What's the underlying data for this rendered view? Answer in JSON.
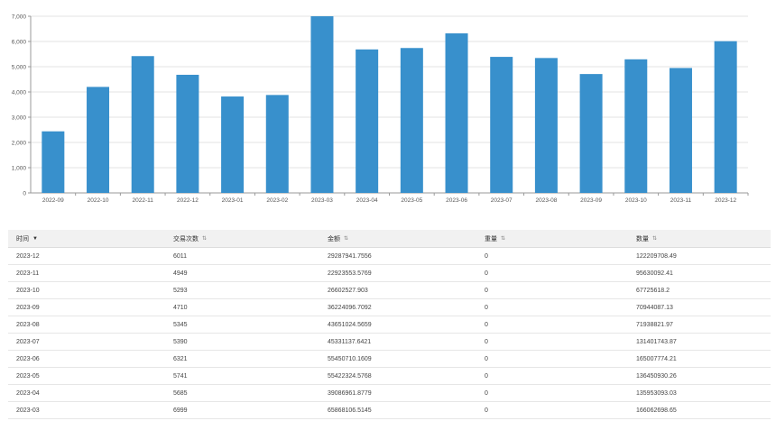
{
  "chart_data": {
    "type": "bar",
    "categories": [
      "2022-09",
      "2022-10",
      "2022-11",
      "2022-12",
      "2023-01",
      "2023-02",
      "2023-03",
      "2023-04",
      "2023-05",
      "2023-06",
      "2023-07",
      "2023-08",
      "2023-09",
      "2023-10",
      "2023-11",
      "2023-12"
    ],
    "values": [
      2440,
      4200,
      5420,
      4680,
      3820,
      3880,
      6999,
      5685,
      5741,
      6321,
      5390,
      5345,
      4710,
      5293,
      4949,
      6011
    ],
    "yticks": [
      "0",
      "1,000",
      "2,000",
      "3,000",
      "4,000",
      "5,000",
      "6,000",
      "7,000"
    ],
    "ylim": [
      0,
      7000
    ],
    "grid": true,
    "bar_color": "#3890cc",
    "title": "",
    "xlabel": "",
    "ylabel": ""
  },
  "table": {
    "columns": [
      "时间",
      "交易次数",
      "金额",
      "重量",
      "数量"
    ],
    "rows": [
      [
        "2023-12",
        "6011",
        "29287941.7556",
        "0",
        "122209708.49"
      ],
      [
        "2023-11",
        "4949",
        "22923553.5769",
        "0",
        "95630092.41"
      ],
      [
        "2023-10",
        "5293",
        "26602527.903",
        "0",
        "67725618.2"
      ],
      [
        "2023-09",
        "4710",
        "36224096.7092",
        "0",
        "70944087.13"
      ],
      [
        "2023-08",
        "5345",
        "43651024.5659",
        "0",
        "71938821.97"
      ],
      [
        "2023-07",
        "5390",
        "45331137.6421",
        "0",
        "131401743.87"
      ],
      [
        "2023-06",
        "6321",
        "55450710.1609",
        "0",
        "165007774.21"
      ],
      [
        "2023-05",
        "5741",
        "55422324.5768",
        "0",
        "136450930.26"
      ],
      [
        "2023-04",
        "5685",
        "39086961.8779",
        "0",
        "135953093.03"
      ],
      [
        "2023-03",
        "6999",
        "65868106.5145",
        "0",
        "166062698.65"
      ]
    ]
  }
}
